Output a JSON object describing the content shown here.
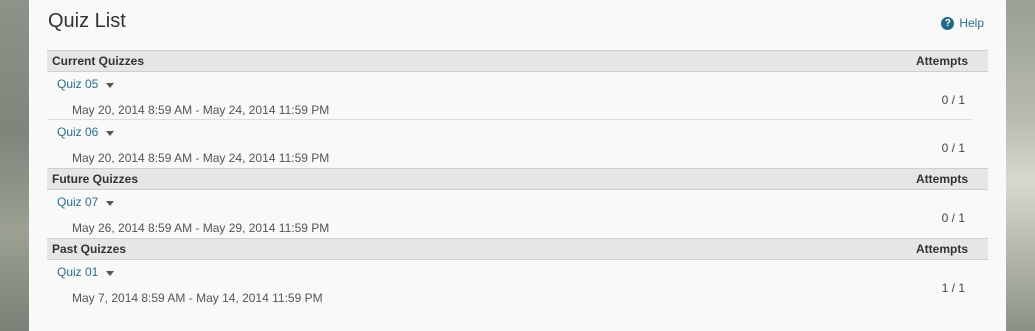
{
  "page": {
    "title": "Quiz List",
    "help_label": "Help",
    "help_icon": "?"
  },
  "sections": [
    {
      "header": "Current Quizzes",
      "attempts_header": "Attempts",
      "rows": [
        {
          "name": "Quiz 05",
          "dates": "May 20, 2014 8:59 AM - May 24, 2014 11:59 PM",
          "attempts": "0 / 1"
        },
        {
          "name": "Quiz 06",
          "dates": "May 20, 2014 8:59 AM - May 24, 2014 11:59 PM",
          "attempts": "0 / 1"
        }
      ]
    },
    {
      "header": "Future Quizzes",
      "attempts_header": "Attempts",
      "rows": [
        {
          "name": "Quiz 07",
          "dates": "May 26, 2014 8:59 AM - May 29, 2014 11:59 PM",
          "attempts": "0 / 1"
        }
      ]
    },
    {
      "header": "Past Quizzes",
      "attempts_header": "Attempts",
      "rows": [
        {
          "name": "Quiz 01",
          "dates": "May 7, 2014 8:59 AM - May 14, 2014 11:59 PM",
          "attempts": "1 / 1"
        }
      ]
    }
  ]
}
